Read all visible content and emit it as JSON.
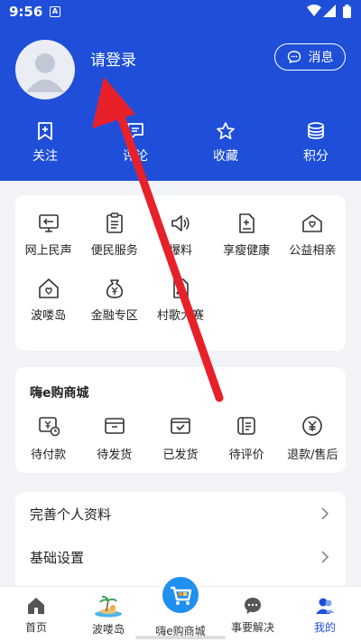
{
  "status_bar": {
    "time": "9:56",
    "notif_glyph": "A"
  },
  "header": {
    "login_label": "请登录",
    "message_button": "消息"
  },
  "quick_actions": [
    {
      "label": "关注",
      "icon": "bookmark-icon"
    },
    {
      "label": "评论",
      "icon": "comment-icon"
    },
    {
      "label": "收藏",
      "icon": "star-icon"
    },
    {
      "label": "积分",
      "icon": "coins-icon"
    }
  ],
  "services": [
    {
      "label": "网上民声",
      "icon": "monitor-icon"
    },
    {
      "label": "便民服务",
      "icon": "clipboard-icon"
    },
    {
      "label": "爆料",
      "icon": "speaker-icon"
    },
    {
      "label": "享瘦健康",
      "icon": "health-doc-icon"
    },
    {
      "label": "公益相亲",
      "icon": "heart-mail-icon"
    },
    {
      "label": "波喽岛",
      "icon": "heart-house-icon"
    },
    {
      "label": "金融专区",
      "icon": "money-bag-icon"
    },
    {
      "label": "村歌大赛",
      "icon": "music-doc-icon"
    }
  ],
  "shop": {
    "title": "嗨e购商城",
    "items": [
      {
        "label": "待付款",
        "icon": "wallet-clock-icon"
      },
      {
        "label": "待发货",
        "icon": "box-icon"
      },
      {
        "label": "已发货",
        "icon": "shipped-box-icon"
      },
      {
        "label": "待评价",
        "icon": "review-icon"
      },
      {
        "label": "退款/售后",
        "icon": "yuan-icon"
      }
    ]
  },
  "settings": [
    {
      "label": "完善个人资料"
    },
    {
      "label": "基础设置"
    }
  ],
  "tabbar": [
    {
      "label": "首页",
      "icon": "home-icon"
    },
    {
      "label": "波喽岛",
      "icon": "island-icon"
    },
    {
      "label": "嗨e购商城",
      "icon": "cart-icon"
    },
    {
      "label": "事要解决",
      "icon": "chat-icon"
    },
    {
      "label": "我的",
      "icon": "profile-icon"
    }
  ],
  "colors": {
    "primary": "#1f4fd8",
    "annotation": "#e8202a"
  }
}
